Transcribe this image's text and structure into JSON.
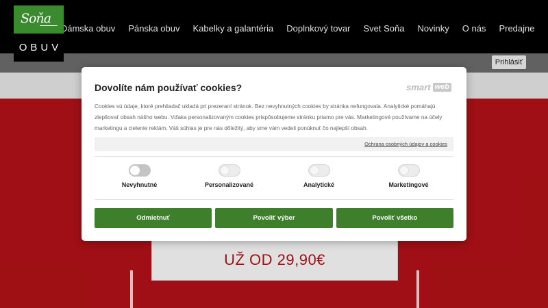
{
  "header": {
    "logo": {
      "script": "Soňa",
      "label": "OBUV"
    },
    "nav": [
      {
        "label": "Dámska obuv"
      },
      {
        "label": "Pánska obuv"
      },
      {
        "label": "Kabelky a galantéria"
      },
      {
        "label": "Doplnkový tovar"
      },
      {
        "label": "Svet Soňa"
      },
      {
        "label": "Novinky"
      },
      {
        "label": "O nás"
      },
      {
        "label": "Predajne"
      }
    ],
    "login_label": "Prihlásiť"
  },
  "promo": {
    "text": "UŽ OD 29,90€"
  },
  "cookie_modal": {
    "title": "Dovolíte nám používať cookies?",
    "brand_smart": "smart",
    "brand_web": "web",
    "description": "Cookies sú údaje, ktoré prehliadač ukladá pri prezeraní stránok. Bez nevyhnutných cookies by stránka nefungovala. Analytické pomáhajú zlepšovať obsah nášho webu. Vďaka personalizovaným cookies prispôsobujeme stránku priamo pre vás. Marketingové používame na účely marketingu a cielenie reklám. Váš súhlas je pre nás dôležitý, aby sme vám vedeli ponúknuť čo najlepší obsah.",
    "privacy_link": "Ochrana osobných údajov a cookies",
    "toggles": [
      {
        "label": "Nevyhnutné",
        "state": "on"
      },
      {
        "label": "Personalizované",
        "state": "off"
      },
      {
        "label": "Analytické",
        "state": "off"
      },
      {
        "label": "Marketingové",
        "state": "off"
      }
    ],
    "buttons": {
      "reject": "Odmietnuť",
      "allow_selection": "Povoliť výber",
      "allow_all": "Povoliť všetko"
    }
  },
  "colors": {
    "brand_green": "#3a8a2e",
    "button_green": "#3d7f2b",
    "promo_red": "#b51218"
  }
}
